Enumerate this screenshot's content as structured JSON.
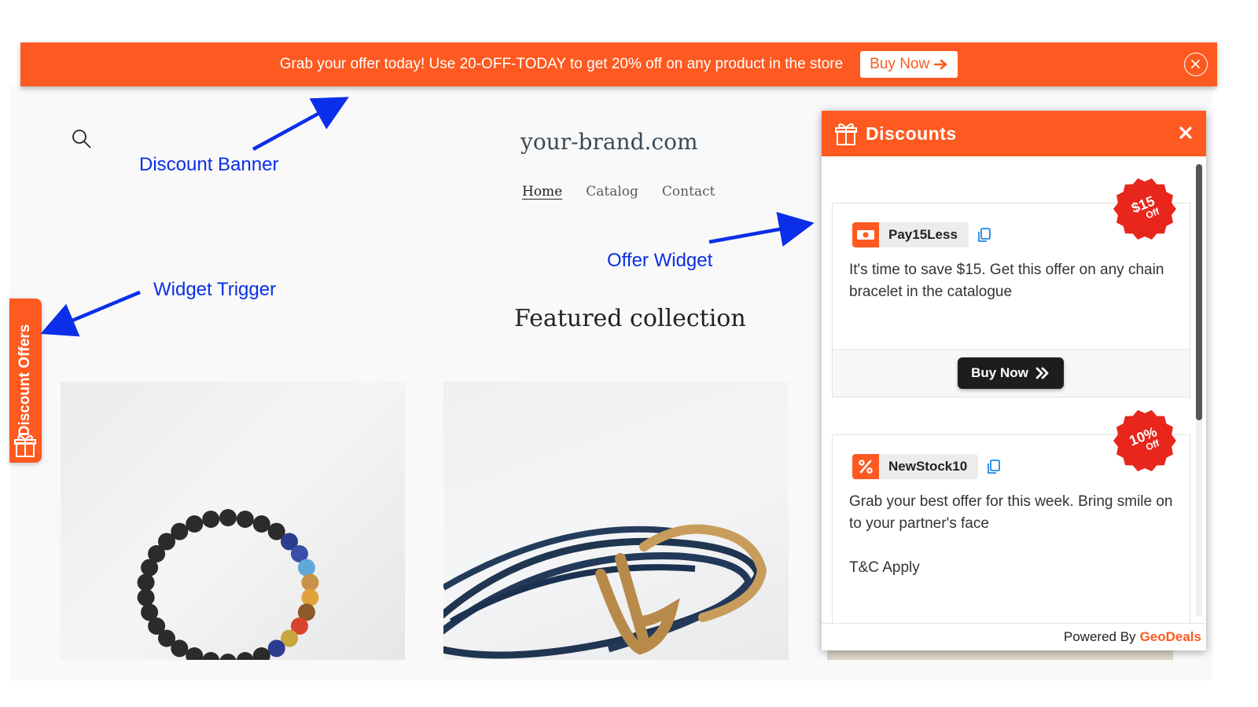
{
  "banner": {
    "text": "Grab your offer today! Use 20-OFF-TODAY to get 20% off on any product in the store",
    "button_label": "Buy Now",
    "button_icon": "arrow-right-icon",
    "close_icon": "close-circle-icon"
  },
  "store": {
    "brand": "your-brand.com",
    "nav": [
      "Home",
      "Catalog",
      "Contact"
    ],
    "active_nav": "Home",
    "section_title": "Featured collection",
    "search_icon": "search-icon"
  },
  "annotations": {
    "banner": "Discount Banner",
    "widget": "Offer Widget",
    "trigger": "Widget Trigger"
  },
  "trigger": {
    "label": "Discount Offers",
    "icon": "gift-icon"
  },
  "widget": {
    "title": "Discounts",
    "title_icon": "gift-icon",
    "close_icon": "close-icon",
    "footer_prefix": "Powered By",
    "footer_brand": "GeoDeals",
    "offers": [
      {
        "code": "Pay15Less",
        "code_icon": "cash-icon",
        "badge_main": "$15",
        "badge_sub": "Off",
        "description": "It's time to save $15.  Get this offer on any chain bracelet in the catalogue",
        "button_label": "Buy Now",
        "button_icon": "double-chevron-right-icon"
      },
      {
        "code": "NewStock10",
        "code_icon": "percent-icon",
        "badge_main": "10%",
        "badge_sub": "Off",
        "description": "Grab your best offer for this week. Bring smile on to your partner's face",
        "terms": "T&C Apply"
      }
    ]
  },
  "colors": {
    "accent": "#fd5920",
    "annotation": "#0b2ee8",
    "button_dark": "#1d1d1d"
  }
}
